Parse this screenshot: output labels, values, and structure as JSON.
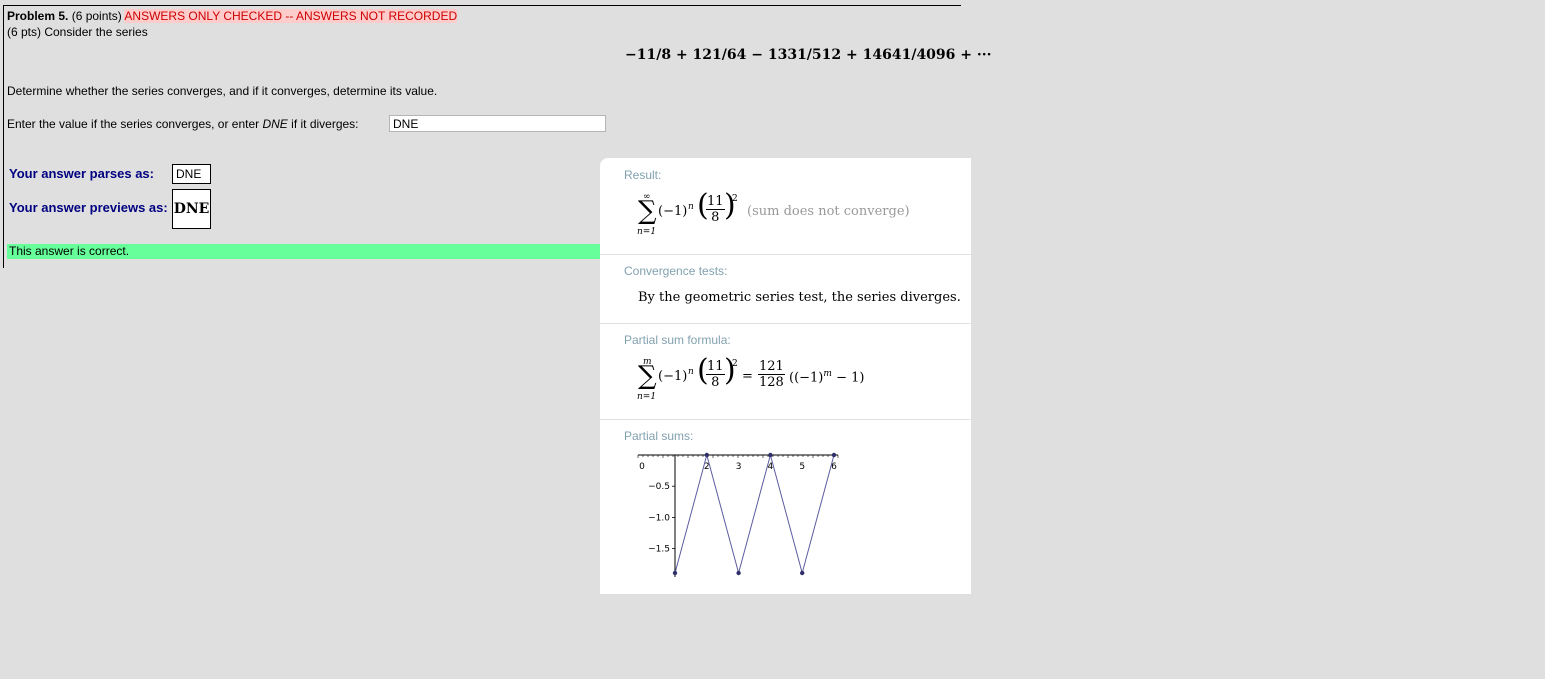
{
  "problem": {
    "number_label": "Problem 5.",
    "points": "(6 points)",
    "status": "ANSWERS ONLY CHECKED -- ANSWERS NOT RECORDED",
    "intro": "(6 pts) Consider the series",
    "series": "−11/8 + 121/64 − 1331/512 + 14641/4096 + ···",
    "question": "Determine whether the series converges, and if it converges, determine its value.",
    "input_prompt_pre": "Enter the value if the series converges, or enter ",
    "input_prompt_em": "DNE",
    "input_prompt_post": " if it diverges:",
    "input_value": "DNE"
  },
  "feedback": {
    "parses_label": "Your answer parses as:",
    "parses_value": "DNE",
    "previews_label": "Your answer previews as:",
    "previews_value": "DNE",
    "status": "This answer is correct.",
    "status_color": "#66ff99"
  },
  "wolfram": {
    "result": {
      "title": "Result:",
      "sum_top": "∞",
      "sum_bottom": "n=1",
      "term": "(−1)",
      "term_exp": "n",
      "frac_num": "11",
      "frac_den": "8",
      "frac_exp": "2",
      "note": "(sum does not converge)"
    },
    "convergence": {
      "title": "Convergence tests:",
      "text": "By the geometric series test, the series diverges."
    },
    "partial_formula": {
      "title": "Partial sum formula:",
      "sum_top": "m",
      "sum_bottom": "n=1",
      "term": "(−1)",
      "term_exp": "n",
      "frac_num": "11",
      "frac_den": "8",
      "frac_exp": "2",
      "equals": "=",
      "rhs_num": "121",
      "rhs_den": "128",
      "rhs_tail": "((−1)",
      "rhs_exp": "m",
      "rhs_end": " − 1)"
    },
    "partial_sums_title": "Partial sums:"
  },
  "chart_data": {
    "type": "line",
    "x": [
      1,
      2,
      3,
      4,
      5,
      6
    ],
    "y": [
      -1.890625,
      0,
      -1.890625,
      0,
      -1.890625,
      0
    ],
    "xticks": [
      "0",
      "2",
      "3",
      "4",
      "5",
      "6"
    ],
    "yticks": [
      "−0.5",
      "−1.0",
      "−1.5"
    ],
    "xlim": [
      0,
      6
    ],
    "ylim": [
      -1.9,
      0
    ],
    "grid": false,
    "line_color": "#5b5b9e",
    "marker_color": "#2f2f6b"
  }
}
